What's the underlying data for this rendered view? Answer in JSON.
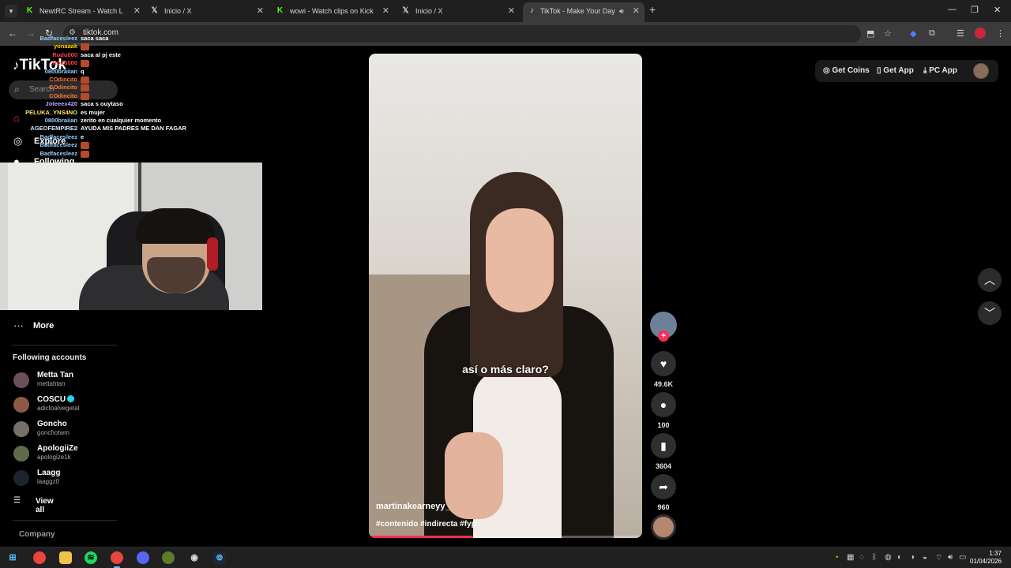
{
  "browser": {
    "tabs": [
      {
        "title": "NewtRC Stream - Watch Live o",
        "icon": "kick-icon"
      },
      {
        "title": "Inicio / X",
        "icon": "x-icon"
      },
      {
        "title": "wowi - Watch clips on Kick",
        "icon": "kick-icon"
      },
      {
        "title": "Inicio / X",
        "icon": "x-icon"
      },
      {
        "title": "TikTok - Make Your Day",
        "icon": "tiktok-icon",
        "active": true
      }
    ],
    "new_tab": "+",
    "url": "tiktok.com"
  },
  "tiktok": {
    "logo": "TikTok",
    "search_placeholder": "Search",
    "sidebar": {
      "explore": "Explore",
      "following": "Following",
      "more": "More",
      "following_accounts_title": "Following accounts",
      "accounts": [
        {
          "name": "Metta Tan",
          "handle": "mettahtan",
          "verified": false,
          "color": "#6b4f5a"
        },
        {
          "name": "COSCU",
          "handle": "adictoalvegetal",
          "verified": true,
          "color": "#8a5a44"
        },
        {
          "name": "Goncho",
          "handle": "gonchotwm",
          "verified": false,
          "color": "#77706a"
        },
        {
          "name": "ApologiiZe",
          "handle": "apologize1k",
          "verified": false,
          "color": "#5e6a48"
        },
        {
          "name": "Laagg",
          "handle": "laaggz0",
          "verified": false,
          "color": "#1b2430"
        }
      ],
      "view_all": "View all",
      "company": "Company"
    },
    "header": {
      "get_coins": "Get Coins",
      "get_app": "Get App",
      "pc_app": "PC App"
    },
    "video": {
      "caption": "así o más claro?",
      "author": "martinakearneyy_",
      "hashtags": "#contenido #indirecta #fyp",
      "progress": 0.38
    },
    "actions": {
      "likes": "49.6K",
      "comments": "100",
      "saves": "3604",
      "shares": "960"
    }
  },
  "chat": [
    {
      "user": "Badfacesleez",
      "msg": "saca saca",
      "color": "#8fd0ff"
    },
    {
      "user": "yonaaak",
      "msg": "",
      "color": "#ffcc00",
      "emote": true
    },
    {
      "user": "Rodu000",
      "msg": "saca al pj este",
      "color": "#ff4040"
    },
    {
      "user": "Rodu000",
      "msg": "",
      "color": "#ff4040",
      "emote": true
    },
    {
      "user": "0800braiian",
      "msg": "q",
      "color": "#8fd0ff"
    },
    {
      "user": "COdincito",
      "msg": "",
      "color": "#ff7a3a",
      "emote": true
    },
    {
      "user": "COdincito",
      "msg": "",
      "color": "#ff7a3a",
      "emote": true
    },
    {
      "user": "COdincito",
      "msg": "",
      "color": "#ff7a3a",
      "emote": true
    },
    {
      "user": "Joteeex420",
      "msg": "saca s ouytaso",
      "color": "#b7a6ff"
    },
    {
      "user": "PELUKA_YNS4NO",
      "msg": "es mujer",
      "color": "#ffe066"
    },
    {
      "user": "0800braiian",
      "msg": "zerito en cualquier momento",
      "color": "#8fd0ff"
    },
    {
      "user": "AGEOFEMPIRE2",
      "msg": "AYUDA MIS PADRES ME DAN FAGAR",
      "color": "#cfe8ff"
    },
    {
      "user": "Badfacesleez",
      "msg": "e",
      "color": "#8fd0ff"
    },
    {
      "user": "Badfacesleez",
      "msg": "",
      "color": "#8fd0ff",
      "emote": true
    },
    {
      "user": "Badfacesleez",
      "msg": "",
      "color": "#8fd0ff",
      "emote": true
    }
  ],
  "taskbar": {
    "time": "1:37",
    "date": "01/04/2026"
  }
}
